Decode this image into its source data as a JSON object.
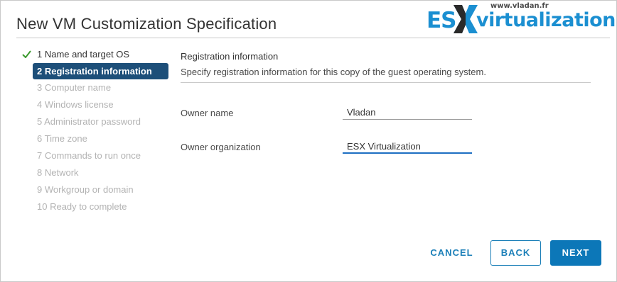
{
  "dialog": {
    "title": "New VM Customization Specification"
  },
  "watermark": {
    "url": "www.vladan.fr",
    "brand": "ESXvirtualization",
    "brand_es": "ES",
    "brand_rest": "virtualization"
  },
  "steps": [
    {
      "label": "1 Name and target OS",
      "state": "done"
    },
    {
      "label": "2 Registration information",
      "state": "active"
    },
    {
      "label": "3 Computer name",
      "state": "pending"
    },
    {
      "label": "4 Windows license",
      "state": "pending"
    },
    {
      "label": "5 Administrator password",
      "state": "pending"
    },
    {
      "label": "6 Time zone",
      "state": "pending"
    },
    {
      "label": "7 Commands to run once",
      "state": "pending"
    },
    {
      "label": "8 Network",
      "state": "pending"
    },
    {
      "label": "9 Workgroup or domain",
      "state": "pending"
    },
    {
      "label": "10 Ready to complete",
      "state": "pending"
    }
  ],
  "section": {
    "title": "Registration information",
    "description": "Specify registration information for this copy of the guest operating system."
  },
  "form": {
    "owner_name": {
      "label": "Owner name",
      "value": "Vladan"
    },
    "owner_organization": {
      "label": "Owner organization",
      "value": "ESX Virtualization"
    }
  },
  "buttons": {
    "cancel": "CANCEL",
    "back": "BACK",
    "next": "NEXT"
  },
  "colors": {
    "accent": "#0c77b8",
    "active_step_bg": "#1d4f79",
    "check_green": "#3c9a2e",
    "brand_blue": "#1b8fd1"
  }
}
